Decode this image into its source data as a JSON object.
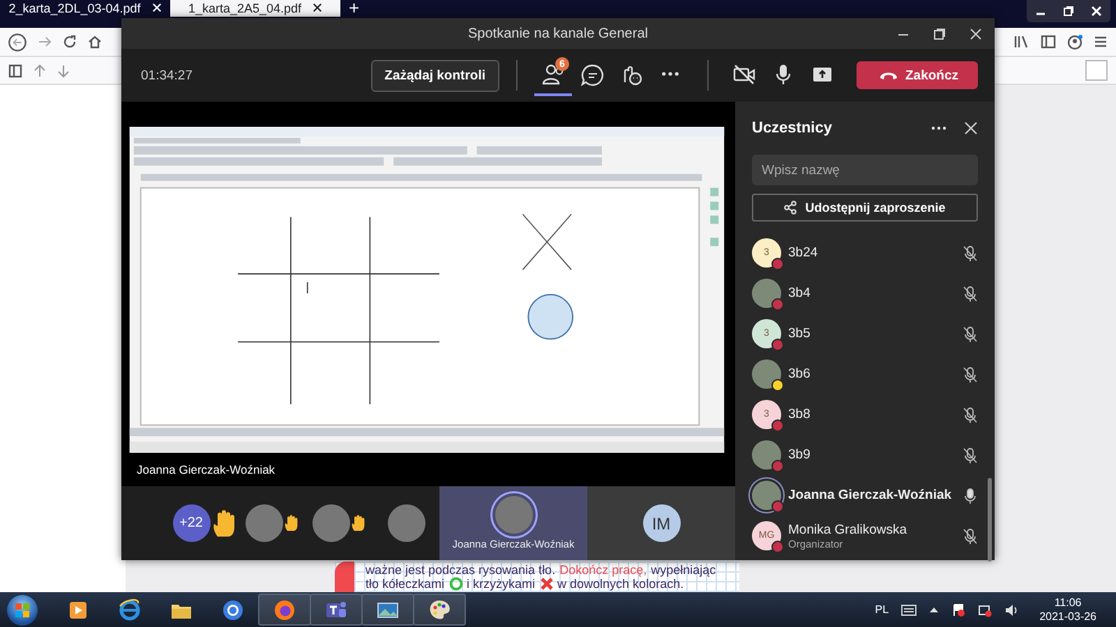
{
  "browser": {
    "tabs": [
      {
        "label": "2_karta_2DL_03-04.pdf",
        "selected": false
      },
      {
        "label": "1_karta_2A5_04.pdf",
        "selected": true
      }
    ],
    "new_tab": "+",
    "document_lines": [
      [
        {
          "kind": "text",
          "text": "ważne jest podczas rysowania tło."
        },
        {
          "kind": "highlight",
          "text": "Dokończ pracę,"
        },
        {
          "kind": "text",
          "text": "wypełniając"
        }
      ],
      [
        {
          "kind": "text",
          "text": "tło kółeczkami"
        },
        {
          "kind": "circle"
        },
        {
          "kind": "text",
          "text": "i krzyżykami"
        },
        {
          "kind": "cross"
        },
        {
          "kind": "text",
          "text": "w dowolnych kolorach."
        }
      ]
    ]
  },
  "teams": {
    "title": "Spotkanie na kanale General",
    "timer": "01:34:27",
    "request_control": "Zażądaj kontroli",
    "toolbar": [
      {
        "kind": "participants",
        "badge": "6",
        "selected": true
      },
      {
        "kind": "chat",
        "selected": false
      },
      {
        "kind": "reactions",
        "selected": false
      },
      {
        "kind": "more",
        "selected": false
      }
    ],
    "camera": {
      "on": false
    },
    "microphone": {
      "on": true
    },
    "end_call": "Zakończ",
    "presenter": "Joanna Gierczak-Woźniak",
    "strip": [
      {
        "kind": "count",
        "label": "+22",
        "hand_raised": true,
        "selected": false
      },
      {
        "kind": "photo",
        "hand_raised": true,
        "selected": false
      },
      {
        "kind": "photo",
        "hand_raised": true,
        "selected": false
      },
      {
        "kind": "photo",
        "hand_raised": false,
        "selected": false
      },
      {
        "kind": "photo",
        "name": "Joanna Gierczak-Woźniak",
        "hand_raised": false,
        "selected": true
      },
      {
        "kind": "initials",
        "label": "IM",
        "hand_raised": false,
        "selected": false
      }
    ],
    "panel": {
      "title": "Uczestnicy",
      "search": {
        "placeholder": "Wpisz nazwę"
      },
      "invite": "Udostępnij zaproszenie",
      "participants": [
        {
          "name": "3b24",
          "avatar": {
            "kind": "initials",
            "text": "3",
            "color": "#fbeec4"
          },
          "color": "#c4314b",
          "speaking": false,
          "muted": true
        },
        {
          "name": "3b4",
          "avatar": {
            "kind": "photo"
          },
          "color": "#c4314b",
          "speaking": false,
          "muted": true
        },
        {
          "name": "3b5",
          "avatar": {
            "kind": "initials",
            "text": "3",
            "color": "#cfe6d6"
          },
          "color": "#c4314b",
          "speaking": false,
          "muted": true
        },
        {
          "name": "3b6",
          "avatar": {
            "kind": "photo"
          },
          "color": "#f8d22a",
          "speaking": false,
          "muted": true
        },
        {
          "name": "3b8",
          "avatar": {
            "kind": "initials",
            "text": "3",
            "color": "#f6d3d8"
          },
          "color": "#c4314b",
          "speaking": false,
          "muted": true
        },
        {
          "name": "3b9",
          "avatar": {
            "kind": "photo"
          },
          "color": "#c4314b",
          "speaking": false,
          "muted": true
        },
        {
          "name": "Joanna Gierczak-Woźniak",
          "avatar": {
            "kind": "photo"
          },
          "color": "#c4314b",
          "speaking": true,
          "muted": false
        },
        {
          "name": "Monika Gralikowska",
          "role": "Organizator",
          "avatar": {
            "kind": "initials",
            "text": "MG",
            "color": "#f6d3d8"
          },
          "color": "#c4314b",
          "speaking": false,
          "muted": true
        }
      ]
    }
  },
  "taskbar": {
    "apps": [
      {
        "kind": "media",
        "open": false
      },
      {
        "kind": "ie",
        "open": false
      },
      {
        "kind": "folder",
        "open": false
      },
      {
        "kind": "chrome",
        "open": false
      },
      {
        "kind": "firefox",
        "open": true
      },
      {
        "kind": "teams",
        "open": true
      },
      {
        "kind": "photos",
        "open": true
      },
      {
        "kind": "paint",
        "open": true
      }
    ],
    "language": "PL",
    "time": "11:06",
    "date": "2021-03-26"
  }
}
